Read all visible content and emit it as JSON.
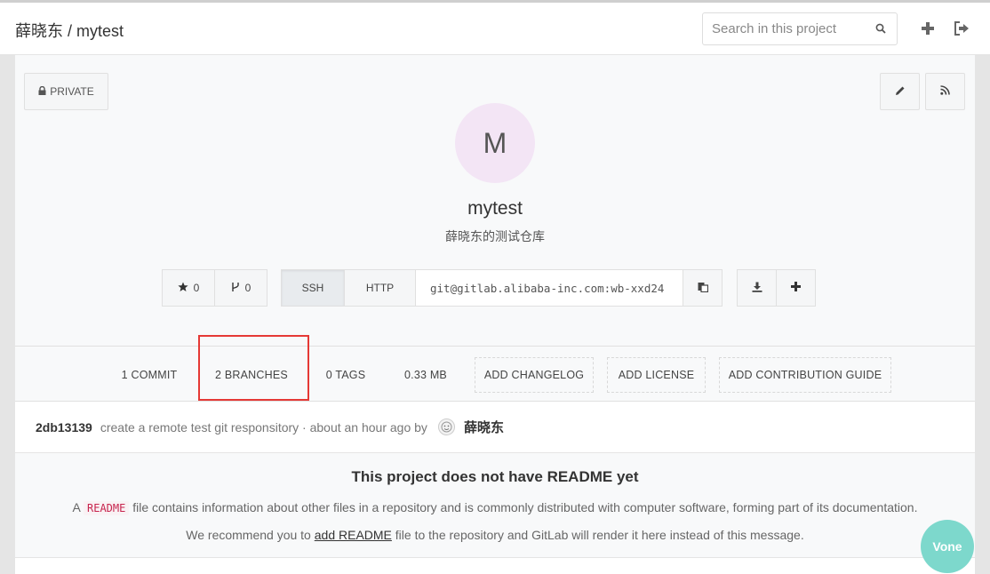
{
  "header": {
    "breadcrumb": "薛晓东 / mytest",
    "search_placeholder": "Search in this project"
  },
  "visibility": {
    "label": "PRIVATE"
  },
  "project": {
    "avatar_letter": "M",
    "name": "mytest",
    "description": "薛晓东的测试仓库"
  },
  "counts": {
    "stars": "0",
    "forks": "0"
  },
  "clone": {
    "ssh_label": "SSH",
    "http_label": "HTTP",
    "url": "git@gitlab.alibaba-inc.com:wb-xxd24"
  },
  "stats": {
    "commits": "1 COMMIT",
    "branches": "2 BRANCHES",
    "tags": "0 TAGS",
    "size": "0.33 MB",
    "add_changelog": "ADD CHANGELOG",
    "add_license": "ADD LICENSE",
    "add_contribution": "ADD CONTRIBUTION GUIDE"
  },
  "commit": {
    "sha": "2db13139",
    "message": "create a remote test git responsitory · about an hour ago by",
    "author": "薛晓东"
  },
  "readme": {
    "title": "This project does not have README yet",
    "line1_pre": "A",
    "line1_code": "README",
    "line1_post": "file contains information about other files in a repository and is commonly distributed with computer software, forming part of its documentation.",
    "line2_pre": "We recommend you to",
    "line2_link": "add README",
    "line2_post": "file to the repository and GitLab will render it here instead of this message."
  },
  "widget": {
    "label": "Vone"
  }
}
